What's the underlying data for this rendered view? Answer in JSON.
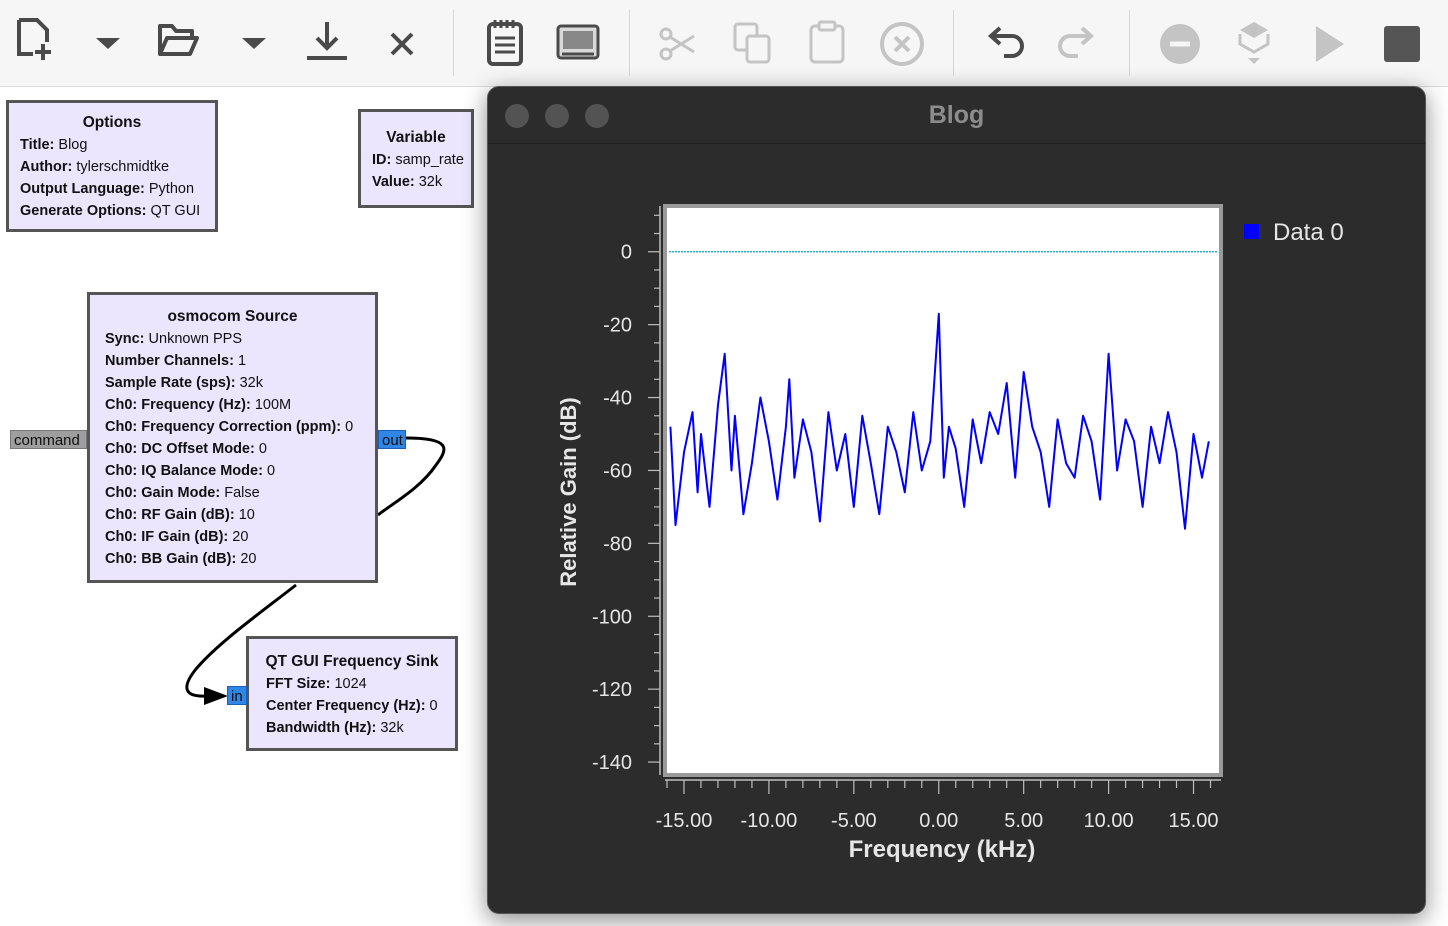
{
  "toolbar": {
    "buttons": [
      {
        "name": "new-file",
        "icon": "new-file-icon",
        "enabled": true
      },
      {
        "name": "new-dropdown",
        "icon": "chevron-down-icon",
        "enabled": true
      },
      {
        "name": "open",
        "icon": "folder-open-icon",
        "enabled": true
      },
      {
        "name": "open-dropdown",
        "icon": "chevron-down-icon",
        "enabled": true
      },
      {
        "name": "save",
        "icon": "download-icon",
        "enabled": true
      },
      {
        "name": "close",
        "icon": "close-icon",
        "enabled": true
      },
      {
        "name": "generate",
        "icon": "notepad-icon",
        "enabled": true
      },
      {
        "name": "screen-capture",
        "icon": "screen-icon",
        "enabled": true
      },
      {
        "name": "cut",
        "icon": "scissors-icon",
        "enabled": false
      },
      {
        "name": "copy",
        "icon": "copy-icon",
        "enabled": false
      },
      {
        "name": "paste",
        "icon": "clipboard-icon",
        "enabled": false
      },
      {
        "name": "delete",
        "icon": "delete-circle-icon",
        "enabled": false
      },
      {
        "name": "undo",
        "icon": "undo-icon",
        "enabled": true
      },
      {
        "name": "redo",
        "icon": "redo-icon",
        "enabled": false
      },
      {
        "name": "disable",
        "icon": "minus-circle-icon",
        "enabled": false
      },
      {
        "name": "bypass",
        "icon": "bypass-icon",
        "enabled": false
      },
      {
        "name": "run",
        "icon": "play-icon",
        "enabled": false
      },
      {
        "name": "stop",
        "icon": "stop-icon",
        "enabled": true
      }
    ]
  },
  "options_block": {
    "title": "Options",
    "rows": [
      {
        "k": "Title:",
        "v": "Blog"
      },
      {
        "k": "Author:",
        "v": "tylerschmidtke"
      },
      {
        "k": "Output Language:",
        "v": "Python"
      },
      {
        "k": "Generate Options:",
        "v": "QT GUI"
      }
    ]
  },
  "variable_block": {
    "title": "Variable",
    "rows": [
      {
        "k": "ID:",
        "v": "samp_rate"
      },
      {
        "k": "Value:",
        "v": "32k"
      }
    ]
  },
  "osmocom_block": {
    "title": "osmocom Source",
    "rows": [
      {
        "k": "Sync:",
        "v": "Unknown PPS"
      },
      {
        "k": "Number Channels:",
        "v": "1"
      },
      {
        "k": "Sample Rate (sps):",
        "v": "32k"
      },
      {
        "k": "Ch0: Frequency (Hz):",
        "v": "100M"
      },
      {
        "k": "Ch0: Frequency Correction (ppm):",
        "v": "0"
      },
      {
        "k": "Ch0: DC Offset Mode:",
        "v": "0"
      },
      {
        "k": "Ch0: IQ Balance Mode:",
        "v": "0"
      },
      {
        "k": "Ch0: Gain Mode:",
        "v": "False"
      },
      {
        "k": "Ch0: RF Gain (dB):",
        "v": "10"
      },
      {
        "k": "Ch0: IF Gain (dB):",
        "v": "20"
      },
      {
        "k": "Ch0: BB Gain (dB):",
        "v": "20"
      }
    ],
    "port_in": "command",
    "port_out": "out"
  },
  "sink_block": {
    "title": "QT GUI Frequency Sink",
    "rows": [
      {
        "k": "FFT Size:",
        "v": "1024"
      },
      {
        "k": "Center Frequency (Hz):",
        "v": "0"
      },
      {
        "k": "Bandwidth (Hz):",
        "v": "32k"
      }
    ],
    "port_in": "in"
  },
  "plot_window": {
    "title": "Blog"
  },
  "chart_data": {
    "type": "line",
    "title": "",
    "xlabel": "Frequency (kHz)",
    "ylabel": "Relative Gain (dB)",
    "xlim": [
      -16.0,
      16.5
    ],
    "ylim": [
      -143,
      12
    ],
    "xticks": [
      -15,
      -10,
      -5,
      0,
      5,
      10,
      15
    ],
    "xtick_labels": [
      "-15.00",
      "-10.00",
      "-5.00",
      "0.00",
      "5.00",
      "10.00",
      "15.00"
    ],
    "yticks": [
      0,
      -20,
      -40,
      -60,
      -80,
      -100,
      -120,
      -140
    ],
    "ytick_labels": [
      "0",
      "-20",
      "-40",
      "-60",
      "-80",
      "-100",
      "-120",
      "-140"
    ],
    "legend_position": "top-right",
    "background": "#ffffff",
    "reference_line": {
      "y": 0,
      "color": "#00a0c8"
    },
    "series": [
      {
        "name": "Data 0",
        "color": "#0000ff",
        "x": [
          -15.8,
          -15.5,
          -15.0,
          -14.5,
          -14.2,
          -14.0,
          -13.5,
          -13.0,
          -12.6,
          -12.2,
          -12.0,
          -11.5,
          -11.0,
          -10.5,
          -10.0,
          -9.5,
          -9.0,
          -8.8,
          -8.5,
          -8.0,
          -7.5,
          -7.0,
          -6.5,
          -6.0,
          -5.5,
          -5.0,
          -4.5,
          -4.0,
          -3.5,
          -3.0,
          -2.5,
          -2.0,
          -1.5,
          -1.0,
          -0.5,
          0.0,
          0.3,
          0.6,
          1.0,
          1.5,
          2.0,
          2.5,
          3.0,
          3.5,
          4.0,
          4.5,
          5.0,
          5.5,
          6.0,
          6.5,
          7.0,
          7.5,
          8.0,
          8.5,
          9.0,
          9.5,
          10.0,
          10.5,
          11.0,
          11.5,
          12.0,
          12.5,
          13.0,
          13.5,
          14.0,
          14.5,
          15.0,
          15.5,
          15.9
        ],
        "y": [
          -48,
          -75,
          -55,
          -44,
          -66,
          -50,
          -70,
          -42,
          -28,
          -60,
          -45,
          -72,
          -58,
          -40,
          -52,
          -68,
          -48,
          -35,
          -62,
          -46,
          -55,
          -74,
          -44,
          -60,
          -50,
          -70,
          -45,
          -58,
          -72,
          -48,
          -55,
          -66,
          -44,
          -60,
          -52,
          -17,
          -62,
          -48,
          -54,
          -70,
          -46,
          -58,
          -44,
          -50,
          -36,
          -62,
          -33,
          -48,
          -55,
          -70,
          -46,
          -58,
          -62,
          -45,
          -52,
          -68,
          -28,
          -60,
          -46,
          -52,
          -70,
          -48,
          -58,
          -44,
          -55,
          -76,
          -50,
          -62,
          -52
        ]
      }
    ]
  }
}
